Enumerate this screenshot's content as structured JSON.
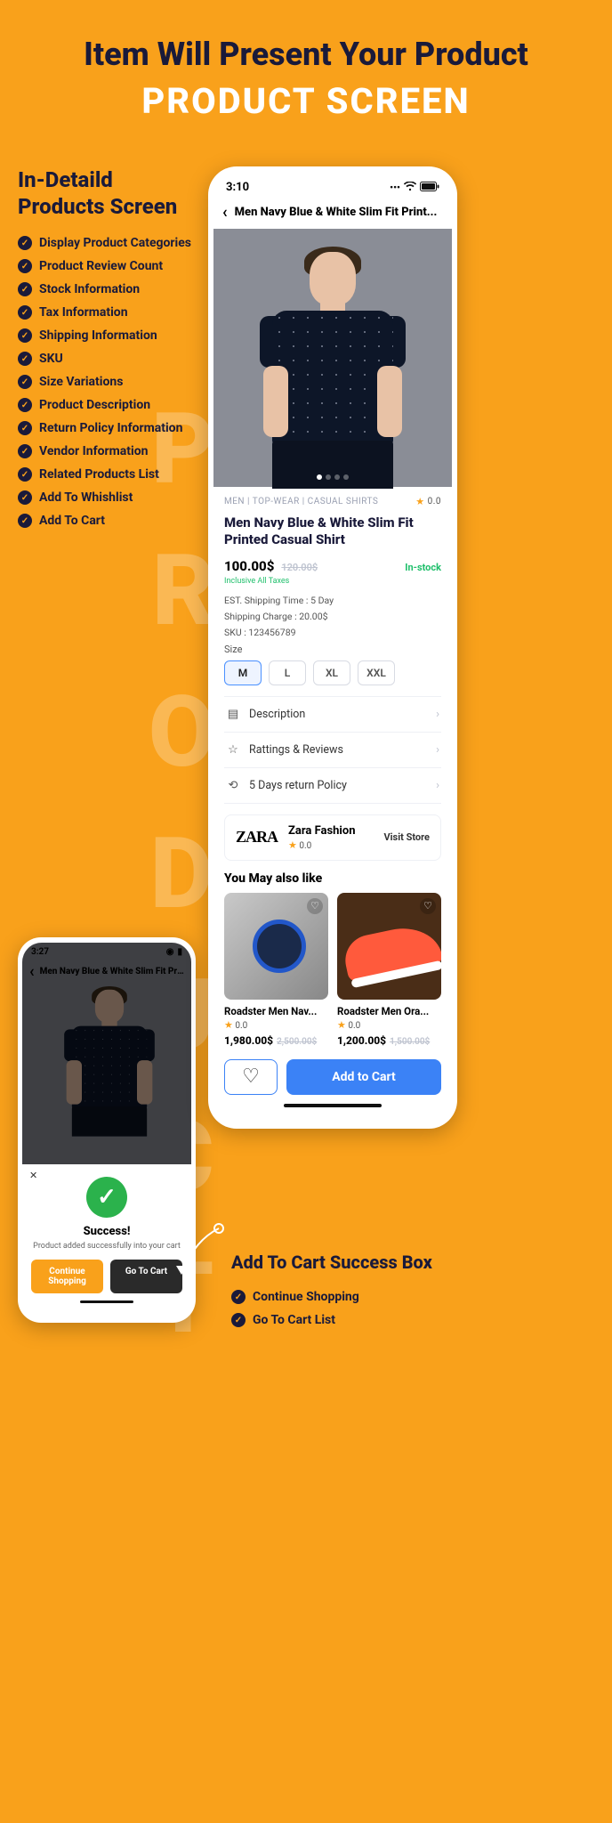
{
  "hero": {
    "line1": "Item Will Present Your Product",
    "line2": "PRODUCT SCREEN"
  },
  "bg_word": "PRODUCT",
  "left": {
    "title": "In-Detaild Products Screen",
    "features": [
      "Display Product Categories",
      "Product Review Count",
      "Stock Information",
      "Tax Information",
      "Shipping Information",
      "SKU",
      "Size Variations",
      "Product Description",
      "Return Policy Information",
      "Vendor Information",
      "Related Products List",
      "Add To Whishlist",
      "Add To Cart"
    ]
  },
  "phone": {
    "time": "3:10",
    "title": "Men Navy Blue & White Slim Fit Print...",
    "breadcrumb": "MEN | TOP-WEAR | CASUAL SHIRTS",
    "top_rating": "0.0",
    "product_title": "Men Navy Blue & White Slim Fit Printed Casual Shirt",
    "price": "100.00$",
    "price_old": "120.00$",
    "stock": "In-stock",
    "tax_note": "Inclusive All Taxes",
    "shipping_time": "EST. Shipping Time : 5 Day",
    "shipping_charge": "Shipping Charge : 20.00$",
    "sku": "SKU : 123456789",
    "size_label": "Size",
    "sizes": [
      "M",
      "L",
      "XL",
      "XXL"
    ],
    "selected_size_index": 0,
    "accordion": {
      "desc": "Description",
      "reviews": "Rattings & Reviews",
      "return": "5 Days return Policy"
    },
    "vendor": {
      "logo": "ZARA",
      "name": "Zara Fashion",
      "rating": "0.0",
      "cta": "Visit Store"
    },
    "you_may": "You May also like",
    "related": [
      {
        "name": "Roadster Men Nav...",
        "rating": "0.0",
        "price": "1,980.00$",
        "old": "2,500.00$"
      },
      {
        "name": "Roadster Men Ora...",
        "rating": "0.0",
        "price": "1,200.00$",
        "old": "1,500.00$"
      }
    ],
    "add_to_cart": "Add to Cart"
  },
  "phone_sm": {
    "time": "3:27",
    "title": "Men Navy Blue & White Slim Fit Print...",
    "success_title": "Success!",
    "success_sub": "Product added successfully into your cart",
    "continue": "Continue Shopping",
    "gocart": "Go To Cart"
  },
  "cart_box": {
    "title": "Add To Cart Success Box",
    "items": [
      "Continue Shopping",
      "Go To Cart List"
    ]
  }
}
